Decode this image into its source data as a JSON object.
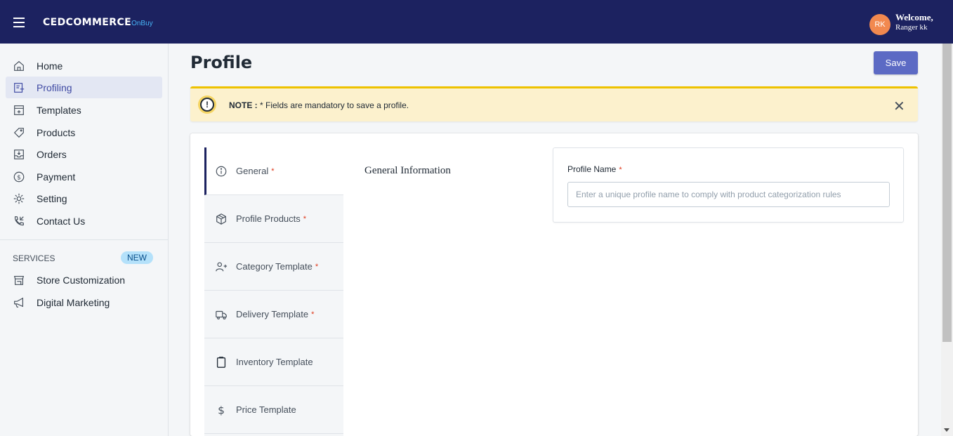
{
  "header": {
    "brand": "CEDCOMMERCE",
    "brand_sub": "OnBuy",
    "avatar_initials": "RK",
    "welcome": "Welcome,",
    "username": "Ranger kk",
    "bg_color": "#1c2260"
  },
  "sidebar": {
    "items": [
      {
        "label": "Home",
        "icon": "home-icon"
      },
      {
        "label": "Profiling",
        "icon": "profiling-icon",
        "active": true
      },
      {
        "label": "Templates",
        "icon": "templates-icon"
      },
      {
        "label": "Products",
        "icon": "tag-icon"
      },
      {
        "label": "Orders",
        "icon": "orders-icon"
      },
      {
        "label": "Payment",
        "icon": "dollar-circle-icon"
      },
      {
        "label": "Setting",
        "icon": "gear-icon"
      },
      {
        "label": "Contact Us",
        "icon": "phone-icon"
      }
    ],
    "services_title": "SERVICES",
    "new_badge": "NEW",
    "services": [
      {
        "label": "Store Customization",
        "icon": "store-icon"
      },
      {
        "label": "Digital Marketing",
        "icon": "megaphone-icon"
      }
    ]
  },
  "main": {
    "title": "Profile",
    "save_label": "Save",
    "note": {
      "icon": "!",
      "label": "NOTE :",
      "text": " * Fields are mandatory to save a profile.",
      "close": "✕"
    },
    "tabs": [
      {
        "label": "General",
        "required": "*",
        "icon": "info-icon",
        "active": true
      },
      {
        "label": "Profile Products",
        "required": "*",
        "icon": "box-icon"
      },
      {
        "label": "Category Template",
        "required": "*",
        "icon": "add-user-icon"
      },
      {
        "label": "Delivery Template",
        "required": "*",
        "icon": "truck-icon"
      },
      {
        "label": "Inventory Template",
        "required": "",
        "icon": "clipboard-icon"
      },
      {
        "label": "Price Template",
        "required": "",
        "icon": "dollar-icon"
      }
    ],
    "section_title": "General Information",
    "profile_name": {
      "label": "Profile Name",
      "required": "*",
      "value": "",
      "placeholder": "Enter a unique profile name to comply with product categorization rules"
    }
  }
}
